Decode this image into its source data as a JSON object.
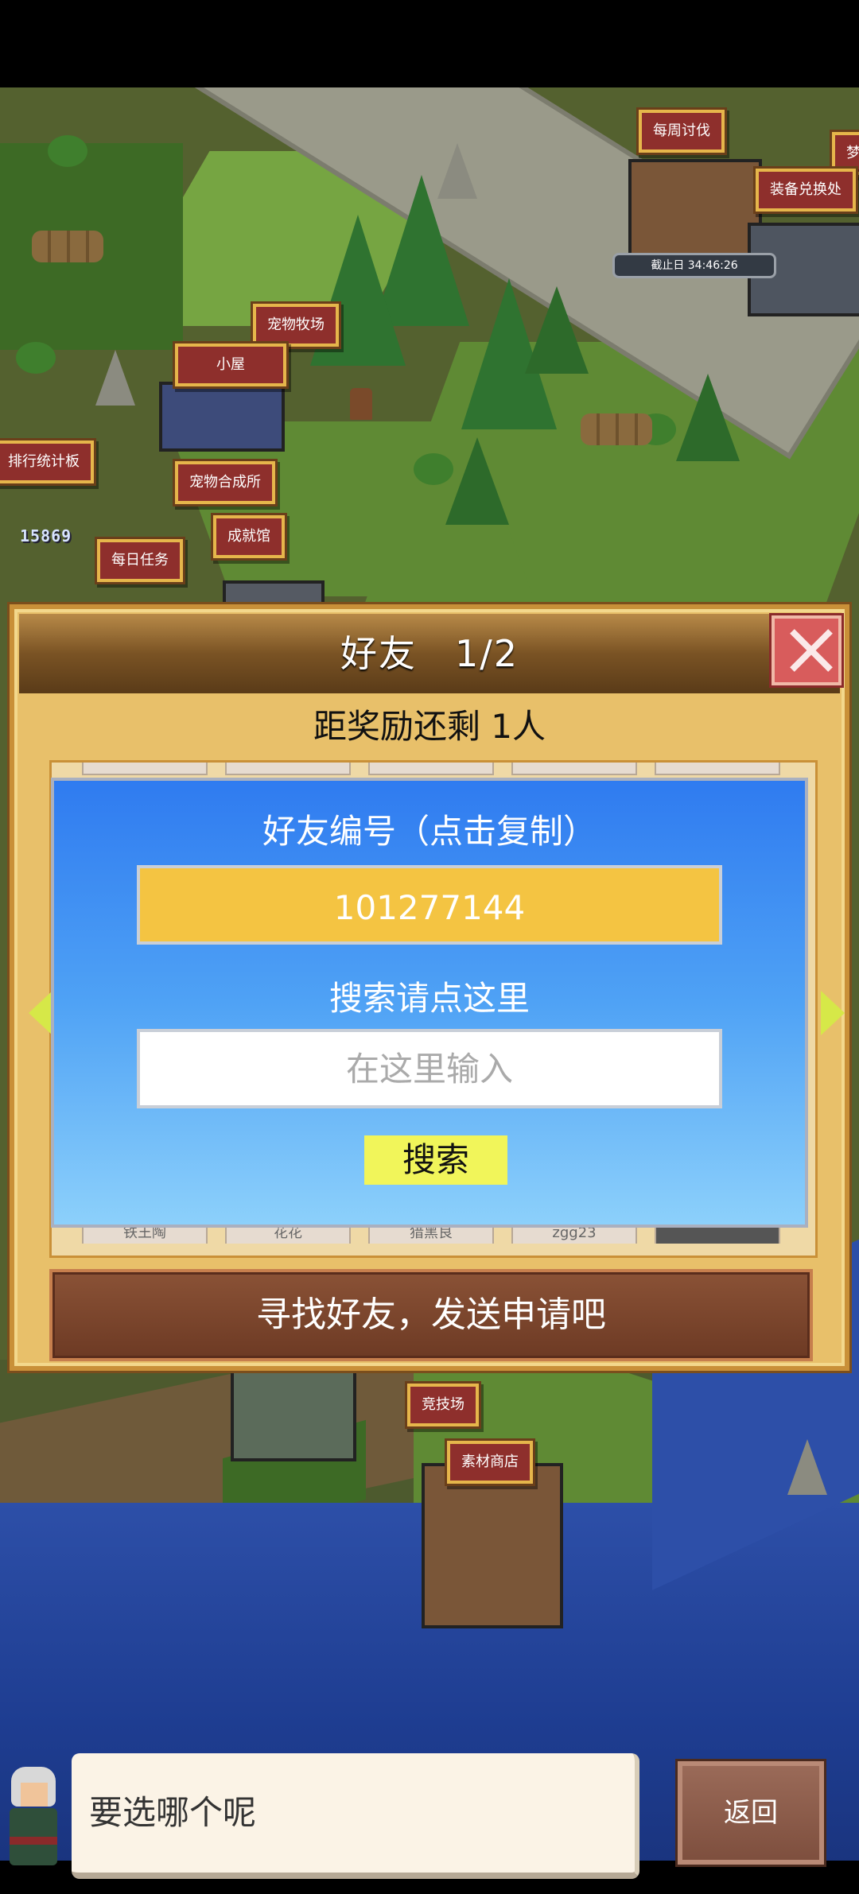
{
  "map": {
    "signs": [
      {
        "id": "weekly",
        "label": "每周讨伐"
      },
      {
        "id": "dream",
        "label": "梦"
      },
      {
        "id": "exchange",
        "label": "装备兑换处"
      },
      {
        "id": "pet-ranch",
        "label": "宠物牧场"
      },
      {
        "id": "hut",
        "label": "小屋"
      },
      {
        "id": "ranking",
        "label": "排行统计板"
      },
      {
        "id": "pet-fusion",
        "label": "宠物合成所"
      },
      {
        "id": "achievement",
        "label": "成就馆"
      },
      {
        "id": "daily",
        "label": "每日任务"
      },
      {
        "id": "arena",
        "label": "竞技场"
      },
      {
        "id": "material-shop",
        "label": "素材商店"
      }
    ],
    "deadline": "截止日 34:46:26",
    "score": "15869"
  },
  "dialog": {
    "title": "好友　1/2",
    "reward_text": "距奖励还剩 1人",
    "friend_tabs": [
      "铁王陶",
      "花花",
      "猎黑良",
      "zgg23",
      ""
    ],
    "panel": {
      "id_label": "好友编号（点击复制）",
      "friend_id": "101277144",
      "search_label": "搜索请点这里",
      "search_placeholder": "在这里输入",
      "search_button": "搜索"
    },
    "find_button": "寻找好友，发送申请吧"
  },
  "bottom": {
    "speech": "要选哪个呢",
    "back_button": "返回"
  },
  "colors": {
    "sign_bg": "#8e2f2c",
    "sign_border": "#e6b64b",
    "panel_top": "#2f7bf0",
    "id_box": "#f4c442",
    "search_btn": "#f1f55a"
  }
}
